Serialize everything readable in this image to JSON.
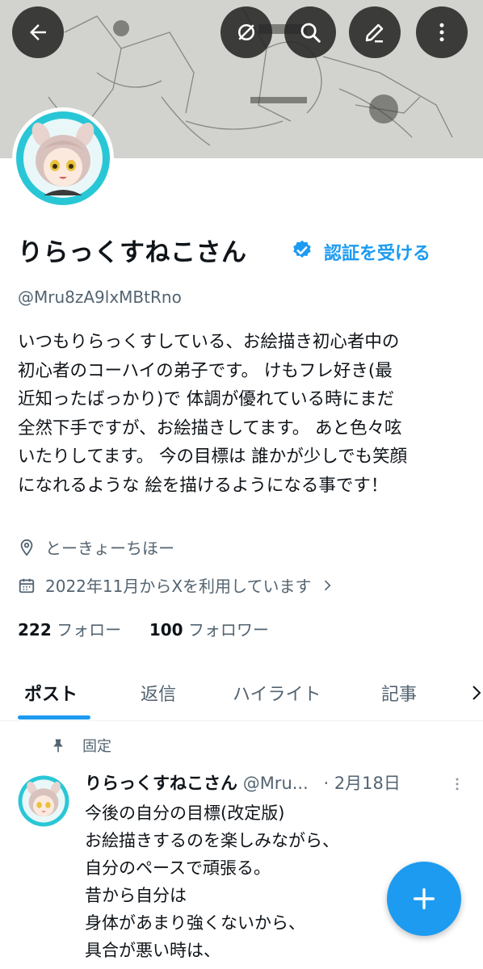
{
  "profile": {
    "display_name": "りらっくすねこさん",
    "verify_link": "認証を受ける",
    "handle": "@Mru8zA9lxMBtRno",
    "bio_lines": [
      "いつもりらっくすしている、お絵描き初心者中の",
      "初心者のコーハイの弟子です。 けもフレ好き(最",
      "近知ったばっかり)で 体調が優れている時にまだ",
      "全然下手ですが、お絵描きしてます。 あと色々呟",
      "いたりしてます。 今の目標は 誰かが少しでも笑顔",
      "になれるような 絵を描けるようになる事です！"
    ],
    "location": "とーきょーちほー",
    "joined": "2022年11月からXを利用しています",
    "following_count": "222",
    "following_label": "フォロー",
    "followers_count": "100",
    "followers_label": "フォロワー"
  },
  "tabs": [
    {
      "label": "ポスト"
    },
    {
      "label": "返信"
    },
    {
      "label": "ハイライト"
    },
    {
      "label": "記事"
    }
  ],
  "post": {
    "pinned_label": "固定",
    "author": "りらっくすねこさん",
    "handle": "@Mru...",
    "date": "· 2月18日",
    "lines": [
      "今後の自分の目標(改定版)",
      "お絵描きするのを楽しみながら、",
      "自分のペースで頑張る。",
      "昔から自分は",
      "身体があまり強くないから、",
      "具合が悪い時は、"
    ]
  },
  "icons": {
    "back": "back-arrow-icon",
    "hide": "eye-slash-icon",
    "search": "search-icon",
    "edit": "pencil-icon",
    "more": "more-vertical-icon",
    "verified": "verified-badge-icon",
    "location": "location-pin-icon",
    "calendar": "calendar-icon",
    "pin": "pin-icon",
    "compose": "plus-icon"
  },
  "colors": {
    "accent": "#1d9bf0",
    "text": "#0f1419",
    "muted": "#536471"
  }
}
